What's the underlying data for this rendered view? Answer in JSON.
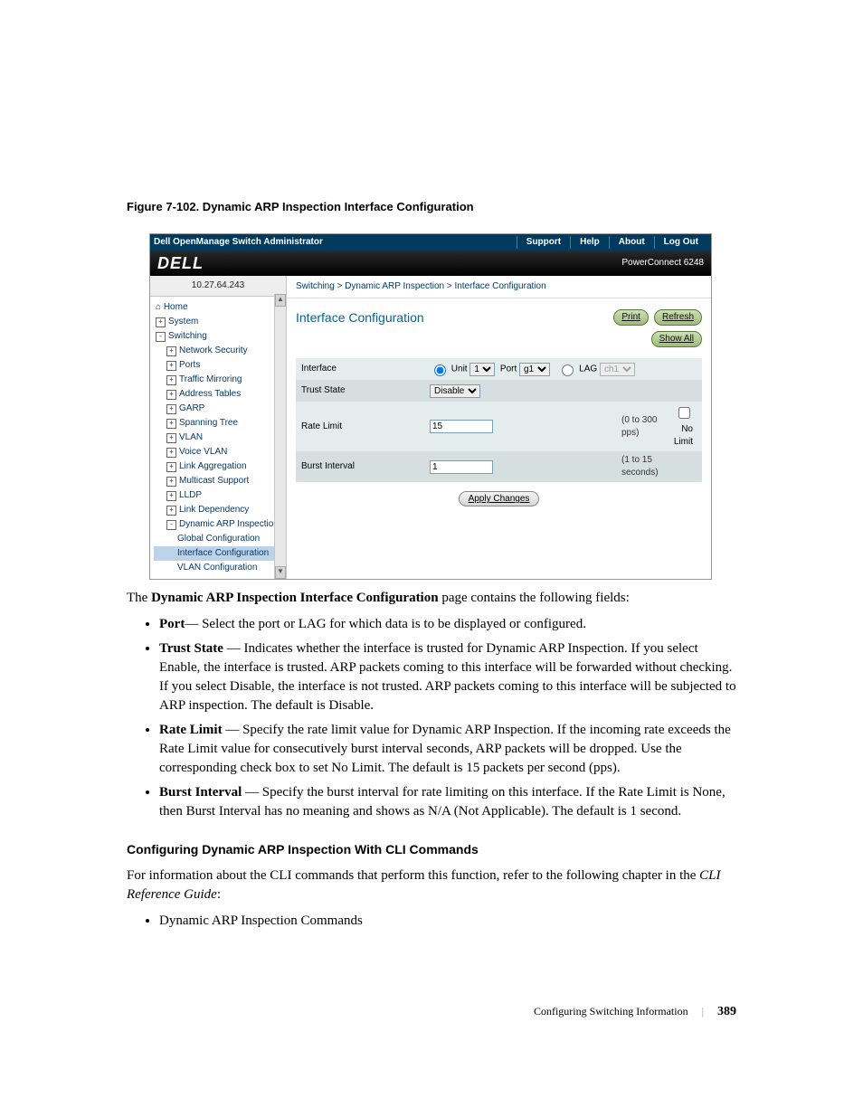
{
  "figcaption": "Figure 7-102.    Dynamic ARP Inspection Interface Configuration",
  "topbar": {
    "title": "Dell OpenManage Switch Administrator",
    "links": [
      "Support",
      "Help",
      "About",
      "Log Out"
    ]
  },
  "brand": {
    "logo": "DELL",
    "model": "PowerConnect 6248"
  },
  "ip": "10.27.64.243",
  "tree": [
    {
      "lvl": 0,
      "exp": "",
      "label": "Home",
      "icon": "home-icon"
    },
    {
      "lvl": 0,
      "exp": "+",
      "label": "System"
    },
    {
      "lvl": 0,
      "exp": "-",
      "label": "Switching"
    },
    {
      "lvl": 1,
      "exp": "+",
      "label": "Network Security"
    },
    {
      "lvl": 1,
      "exp": "+",
      "label": "Ports"
    },
    {
      "lvl": 1,
      "exp": "+",
      "label": "Traffic Mirroring"
    },
    {
      "lvl": 1,
      "exp": "+",
      "label": "Address Tables"
    },
    {
      "lvl": 1,
      "exp": "+",
      "label": "GARP"
    },
    {
      "lvl": 1,
      "exp": "+",
      "label": "Spanning Tree"
    },
    {
      "lvl": 1,
      "exp": "+",
      "label": "VLAN"
    },
    {
      "lvl": 1,
      "exp": "+",
      "label": "Voice VLAN"
    },
    {
      "lvl": 1,
      "exp": "+",
      "label": "Link Aggregation"
    },
    {
      "lvl": 1,
      "exp": "+",
      "label": "Multicast Support"
    },
    {
      "lvl": 1,
      "exp": "+",
      "label": "LLDP"
    },
    {
      "lvl": 1,
      "exp": "+",
      "label": "Link Dependency"
    },
    {
      "lvl": 1,
      "exp": "-",
      "label": "Dynamic ARP Inspection"
    },
    {
      "lvl": 2,
      "exp": "",
      "label": "Global Configuration"
    },
    {
      "lvl": 2,
      "exp": "",
      "label": "Interface Configuration",
      "selected": true
    },
    {
      "lvl": 2,
      "exp": "",
      "label": "VLAN Configuration"
    }
  ],
  "breadcrumb": "Switching > Dynamic ARP Inspection > Interface Configuration",
  "pagetitle": "Interface Configuration",
  "buttons": {
    "print": "Print",
    "refresh": "Refresh",
    "showall": "Show All",
    "apply": "Apply Changes"
  },
  "form": {
    "rows": [
      {
        "label": "Interface",
        "type": "radio-row",
        "unit_label": "Unit",
        "unit_value": "1",
        "port_label": "Port",
        "port_value": "g1",
        "lag_label": "LAG",
        "lag_value": "ch1"
      },
      {
        "label": "Trust State",
        "type": "select",
        "value": "Disable"
      },
      {
        "label": "Rate Limit",
        "type": "text",
        "value": "15",
        "hint": "(0 to 300 pps)",
        "cb_label": "No Limit"
      },
      {
        "label": "Burst Interval",
        "type": "text",
        "value": "1",
        "hint": "(1 to 15 seconds)"
      }
    ]
  },
  "doc": {
    "intro_pre": "The ",
    "intro_bold": "Dynamic ARP Inspection Interface Configuration",
    "intro_post": " page contains the following fields:",
    "bullets": [
      {
        "b": "Port",
        "t": "— Select the port or LAG for which data is to be displayed or configured."
      },
      {
        "b": "Trust State",
        "t": " — Indicates whether the interface is trusted for Dynamic ARP Inspection. If you select Enable, the interface is trusted. ARP packets coming to this interface will be forwarded without checking. If you select Disable, the interface is not trusted. ARP packets coming to this interface will be subjected to ARP inspection. The default is Disable."
      },
      {
        "b": "Rate Limit",
        "t": " — Specify the rate limit value for Dynamic ARP Inspection. If the incoming rate exceeds the Rate Limit value for consecutively burst interval seconds, ARP packets will be dropped. Use the corresponding check box to set No Limit. The default is 15 packets per second (pps)."
      },
      {
        "b": "Burst Interval",
        "t": " — Specify the burst interval for rate limiting on this interface. If the Rate Limit is None, then Burst Interval has no meaning and shows as N/A (Not Applicable). The default is 1 second."
      }
    ],
    "subhead": "Configuring Dynamic ARP Inspection With CLI Commands",
    "cli_pre": "For information about the CLI commands that perform this function, refer to the following chapter in the ",
    "cli_em": "CLI Reference Guide",
    "cli_post": ":",
    "cli_bullet": "Dynamic ARP Inspection Commands",
    "footer_section": "Configuring Switching Information",
    "footer_page": "389"
  }
}
